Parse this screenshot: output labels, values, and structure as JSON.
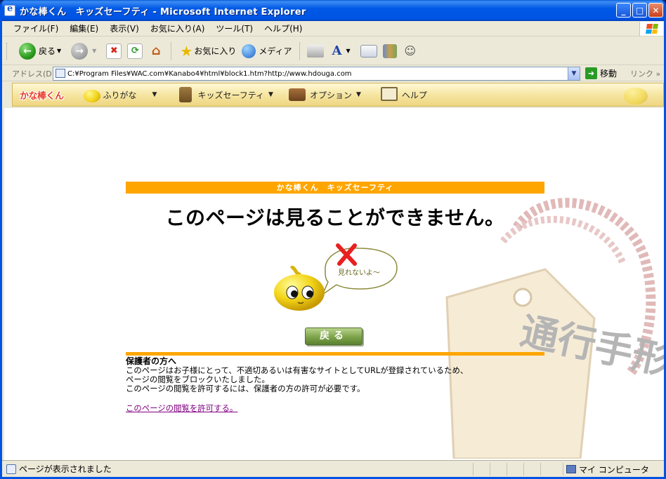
{
  "window": {
    "title": "かな棒くん　キッズセーフティ - Microsoft Internet Explorer"
  },
  "menu": [
    "ファイル(F)",
    "編集(E)",
    "表示(V)",
    "お気に入り(A)",
    "ツール(T)",
    "ヘルプ(H)"
  ],
  "toolbar": {
    "back_label": "戻る",
    "favorites_label": "お気に入り",
    "media_label": "メディア"
  },
  "address": {
    "label": "アドレス(D)",
    "url": "C:¥Program Files¥WAC.com¥Kanabo4¥html¥block1.htm?http://www.hdouga.com",
    "go_label": "移動",
    "links_label": "リンク"
  },
  "kana_toolbar": {
    "logo": "かな棒くん",
    "furigana_label": "ふりがな",
    "kids_safety_label": "キッズセーフティ",
    "option_label": "オプション",
    "help_label": "ヘルプ"
  },
  "page": {
    "banner": "かな棒くん　キッズセーフティ",
    "headline": "このページは見ることができません。",
    "bubble_text": "見れないよ～",
    "back_button": "戻る",
    "notice_title": "保護者の方へ",
    "notice_lines": [
      "このページはお子様にとって、不適切あるいは有害なサイトとしてURLが登録されているため、",
      "ページの閲覧をブロックいたしました。",
      "このページの閲覧を許可するには、保護者の方の許可が必要です。"
    ],
    "allow_link": "このページの閲覧を許可する。",
    "tag_text": "通行手形"
  },
  "status": {
    "text": "ページが表示されました",
    "zone": "マイ コンピュータ"
  },
  "colors": {
    "accent_orange": "#ffa500",
    "link_visited": "#800080",
    "titlebar_blue": "#0054e3"
  }
}
